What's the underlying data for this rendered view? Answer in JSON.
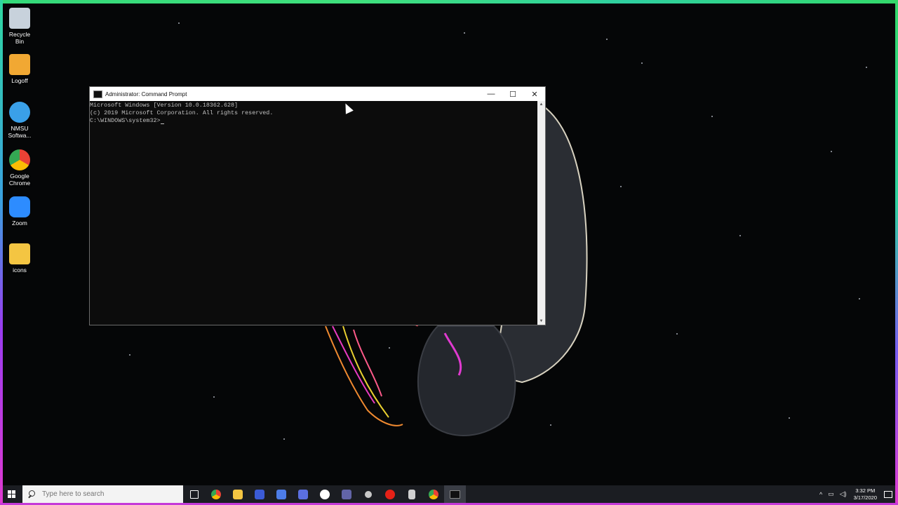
{
  "desktop": {
    "icons": [
      {
        "label": "Recycle Bin",
        "icon": "recycle-bin-icon",
        "color": "#c8d2dc"
      },
      {
        "label": "Logoff",
        "icon": "key-icon",
        "color": "#f1a833"
      },
      {
        "label": "NMSU Softwa...",
        "icon": "globe-install-icon",
        "color": "#3aa0e8"
      },
      {
        "label": "Google Chrome",
        "icon": "chrome-icon",
        "color": "#e94235"
      },
      {
        "label": "Zoom",
        "icon": "zoom-icon",
        "color": "#2d8cff"
      },
      {
        "label": "icons",
        "icon": "folder-zip-icon",
        "color": "#f4c542"
      }
    ]
  },
  "cmd": {
    "title": "Administrator: Command Prompt",
    "controls": {
      "minimize": "—",
      "maximize": "☐",
      "close": "✕"
    },
    "lines": [
      "Microsoft Windows [Version 10.0.18362.628]",
      "(c) 2019 Microsoft Corporation. All rights reserved.",
      "",
      "C:\\WINDOWS\\system32>"
    ]
  },
  "taskbar": {
    "search_placeholder": "Type here to search",
    "apps": [
      {
        "name": "task-view-icon",
        "color": "#ffffff"
      },
      {
        "name": "chrome-icon",
        "color": "#e94235"
      },
      {
        "name": "file-explorer-icon",
        "color": "#f4c542"
      },
      {
        "name": "app-blue-icon",
        "color": "#3b5bd6"
      },
      {
        "name": "app-doc-icon",
        "color": "#4d7de8"
      },
      {
        "name": "app-word-icon",
        "color": "#5b6fe0"
      },
      {
        "name": "app-xbox-icon",
        "color": "#ffffff"
      },
      {
        "name": "teams-icon",
        "color": "#6264a7"
      },
      {
        "name": "network-icon",
        "color": "#c8c8c8"
      },
      {
        "name": "youtube-icon",
        "color": "#e62117"
      },
      {
        "name": "calculator-icon",
        "color": "#d0d0d0"
      },
      {
        "name": "chrome-alt-icon",
        "color": "#e94235"
      },
      {
        "name": "cmd-icon",
        "color": "#111111"
      }
    ],
    "tray": {
      "time": "3:32 PM",
      "date": "3/17/2020"
    }
  }
}
